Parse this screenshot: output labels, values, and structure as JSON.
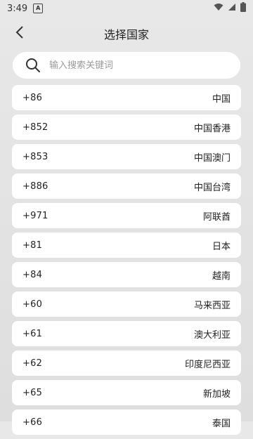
{
  "status_bar": {
    "time": "3:49",
    "notification_icon": "A"
  },
  "header": {
    "title": "选择国家"
  },
  "search": {
    "placeholder": "输入搜索关键词"
  },
  "countries": [
    {
      "code": "+86",
      "name": "中国"
    },
    {
      "code": "+852",
      "name": "中国香港"
    },
    {
      "code": "+853",
      "name": "中国澳门"
    },
    {
      "code": "+886",
      "name": "中国台湾"
    },
    {
      "code": "+971",
      "name": "阿联酋"
    },
    {
      "code": "+81",
      "name": "日本"
    },
    {
      "code": "+84",
      "name": "越南"
    },
    {
      "code": "+60",
      "name": "马来西亚"
    },
    {
      "code": "+61",
      "name": "澳大利亚"
    },
    {
      "code": "+62",
      "name": "印度尼西亚"
    },
    {
      "code": "+65",
      "name": "新加坡"
    },
    {
      "code": "+66",
      "name": "泰国"
    }
  ],
  "icons": {
    "back": "chevron-left-icon",
    "search": "search-icon",
    "wifi": "wifi-icon",
    "signal": "signal-icon",
    "battery": "battery-icon"
  }
}
